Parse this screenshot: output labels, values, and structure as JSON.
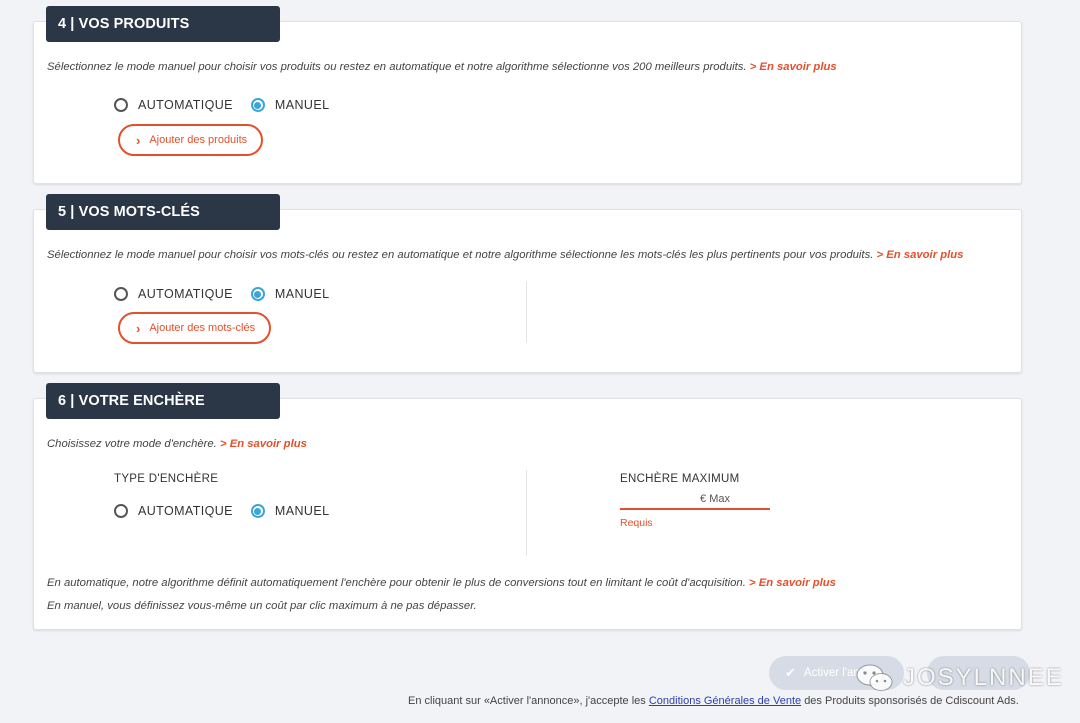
{
  "section4": {
    "title": "4 | VOS PRODUITS",
    "description": "Sélectionnez le mode manuel pour choisir vos produits ou restez en automatique et notre algorithme sélectionne vos 200 meilleurs produits.",
    "learn_more": "> En savoir plus",
    "option_auto": "AUTOMATIQUE",
    "option_manual": "MANUEL",
    "selected": "MANUEL",
    "add_button": "Ajouter des produits"
  },
  "section5": {
    "title": "5 | VOS MOTS-CLÉS",
    "description": "Sélectionnez le mode manuel pour choisir vos mots-clés ou restez en automatique et notre algorithme sélectionne les mots-clés les plus pertinents pour vos produits.",
    "learn_more": "> En savoir plus",
    "option_auto": "AUTOMATIQUE",
    "option_manual": "MANUEL",
    "selected": "MANUEL",
    "add_button": "Ajouter des mots-clés"
  },
  "section6": {
    "title": "6 | VOTRE ENCHÈRE",
    "description": "Choisissez votre mode d'enchère.",
    "learn_more": "> En savoir plus",
    "bid_type_label": "TYPE D'ENCHÈRE",
    "option_auto": "AUTOMATIQUE",
    "option_manual": "MANUEL",
    "selected": "MANUEL",
    "max_bid_label": "ENCHÈRE MAXIMUM",
    "max_bid_placeholder": "€ Max",
    "max_bid_value": "",
    "required_text": "Requis",
    "note_auto": "En automatique, notre algorithme définit automatiquement l'enchère pour obtenir le plus de conversions tout en limitant le coût d'acquisition.",
    "note_auto_more": "> En savoir plus",
    "note_manual": "En manuel, vous définissez vous-même un coût par clic maximum à ne pas dépasser."
  },
  "actions": {
    "activate_label": "Activer l'an",
    "check_icon": "check-icon"
  },
  "footer": {
    "prefix": "En cliquant sur «Activer l'annonce», j'accepte les",
    "link": "Conditions Générales de Vente",
    "suffix": "des Produits sponsorisés de Cdiscount Ads."
  },
  "watermark": {
    "text": "JOSYLNNEE",
    "icon": "wechat-icon"
  },
  "colors": {
    "accent": "#e4502b",
    "tab_bg": "#2b3646",
    "radio_selected": "#3aa6d8",
    "link": "#2b3fb0",
    "page_bg": "#f2f3f7"
  }
}
